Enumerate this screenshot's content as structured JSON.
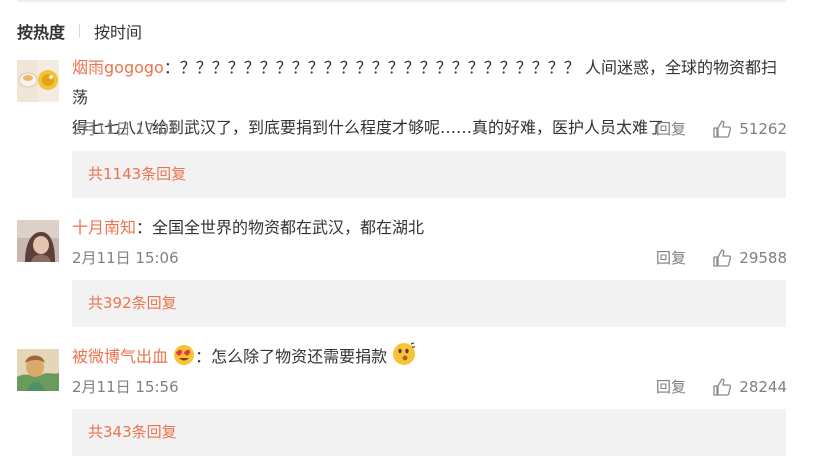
{
  "sort": {
    "hot": "按热度",
    "time": "按时间"
  },
  "comments": [
    {
      "user": "烟雨gogogo",
      "colon": "：",
      "line1": "？？？？？？？？？？？？？？？？？？？？？？？？？ 人间迷惑，全球的物资都扫荡",
      "line2": "得七七八八给到武汉了，到底要捐到什么程度才够呢……真的好难，医护人员太难了",
      "time": "2月11日 17:08",
      "reply_label": "回复",
      "likes": "51262",
      "replies": "共1143条回复"
    },
    {
      "user": "十月南知",
      "colon": "：",
      "text": "全国全世界的物资都在武汉，都在湖北",
      "time": "2月11日 15:06",
      "reply_label": "回复",
      "likes": "29588",
      "replies": "共392条回复"
    },
    {
      "user": "被微博气出血",
      "colon": "：",
      "text": "怎么除了物资还需要捐款",
      "time": "2月11日 15:56",
      "reply_label": "回复",
      "likes": "28244",
      "replies": "共343条回复",
      "user_badge_icon": "heart-eyes-emoji-icon",
      "text_emoji_icon": "thinking-face-emoji-icon"
    }
  ],
  "colors": {
    "accent": "#eb7350",
    "meta": "#808080",
    "reply_bg": "#f2f2f2"
  }
}
